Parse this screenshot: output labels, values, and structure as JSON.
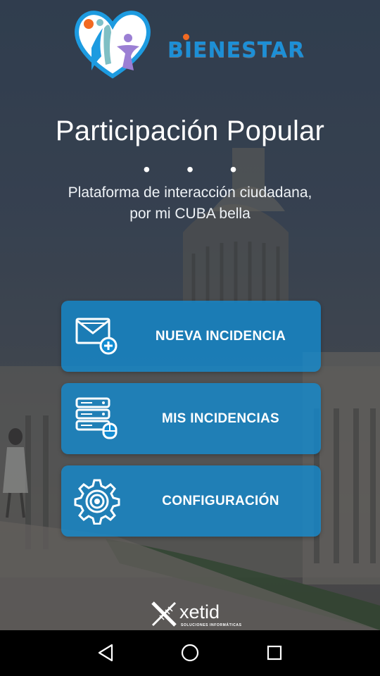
{
  "app": {
    "brand_name": "BIENESTAR",
    "title": "Participación Popular",
    "separator": "• • •",
    "subtitle_line1": "Plataforma de interacción ciudadana,",
    "subtitle_line2": "por mi CUBA bella"
  },
  "menu": {
    "items": [
      {
        "label": "NUEVA INCIDENCIA",
        "icon": "envelope-plus-icon"
      },
      {
        "label": "MIS INCIDENCIAS",
        "icon": "server-stack-icon"
      },
      {
        "label": "CONFIGURACIÓN",
        "icon": "gear-icon"
      }
    ]
  },
  "footer": {
    "brand": "xetid",
    "tagline": "SOLUCIONES INFORMÁTICAS"
  },
  "navbar": {
    "back_icon": "triangle-back-icon",
    "home_icon": "circle-home-icon",
    "recents_icon": "square-recents-icon"
  },
  "colors": {
    "button_bg": "#128cd2",
    "brand_blue": "#1d8fd6",
    "accent_orange": "#f26a22",
    "heart_purple": "#9b7fd4",
    "text": "#ffffff"
  }
}
